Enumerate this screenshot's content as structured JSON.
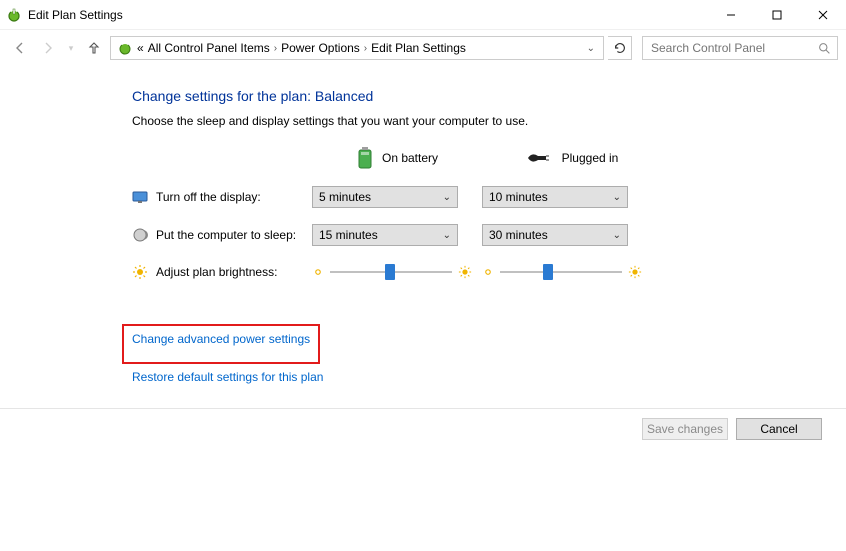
{
  "window": {
    "title": "Edit Plan Settings"
  },
  "breadcrumb": {
    "prefix": "«",
    "items": [
      "All Control Panel Items",
      "Power Options",
      "Edit Plan Settings"
    ]
  },
  "search": {
    "placeholder": "Search Control Panel"
  },
  "page": {
    "heading": "Change settings for the plan: Balanced",
    "subtext": "Choose the sleep and display settings that you want your computer to use."
  },
  "columns": {
    "battery": "On battery",
    "plugged": "Plugged in"
  },
  "rows": {
    "display": {
      "label": "Turn off the display:",
      "battery": "5 minutes",
      "plugged": "10 minutes"
    },
    "sleep": {
      "label": "Put the computer to sleep:",
      "battery": "15 minutes",
      "plugged": "30 minutes"
    },
    "brightness": {
      "label": "Adjust plan brightness:",
      "battery_pct": 45,
      "plugged_pct": 35
    }
  },
  "links": {
    "advanced": "Change advanced power settings",
    "restore": "Restore default settings for this plan"
  },
  "buttons": {
    "save": "Save changes",
    "cancel": "Cancel"
  }
}
